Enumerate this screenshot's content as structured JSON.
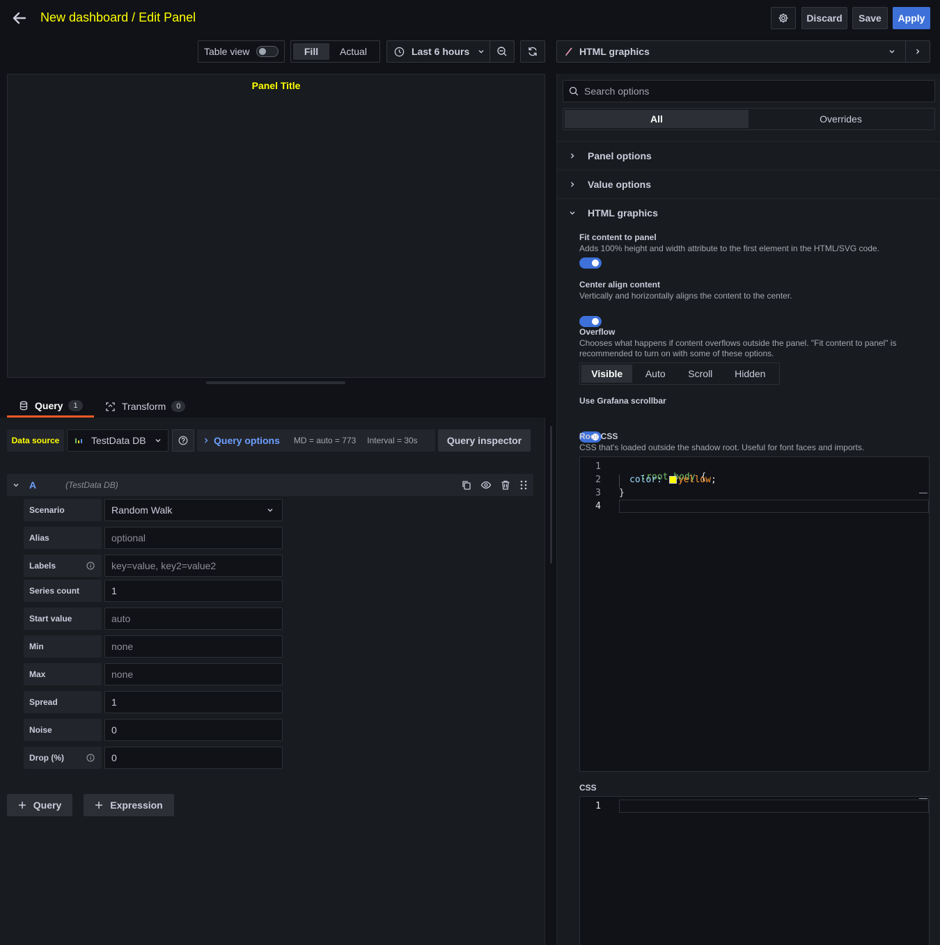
{
  "header": {
    "title": "New dashboard / Edit Panel",
    "discard": "Discard",
    "save": "Save",
    "apply": "Apply"
  },
  "toolbar": {
    "table_view": "Table view",
    "fill": "Fill",
    "actual": "Actual",
    "time_range": "Last 6 hours",
    "visualization": "HTML graphics"
  },
  "preview": {
    "panel_title": "Panel Title"
  },
  "query_tabs": {
    "query": "Query",
    "query_count": "1",
    "transform": "Transform",
    "transform_count": "0"
  },
  "datasource_row": {
    "label": "Data source",
    "value": "TestData DB",
    "query_options": "Query options",
    "md": "MD = auto = 773",
    "interval": "Interval = 30s",
    "inspector": "Query inspector"
  },
  "query_row": {
    "ref": "A",
    "ds": "(TestData DB)"
  },
  "fields": [
    {
      "label": "Scenario",
      "value": "Random Walk",
      "placeholder": false
    },
    {
      "label": "Alias",
      "value": "optional",
      "placeholder": true
    },
    {
      "label": "Labels",
      "value": "key=value, key2=value2",
      "placeholder": true
    },
    {
      "label": "Series count",
      "value": "1",
      "placeholder": false
    },
    {
      "label": "Start value",
      "value": "auto",
      "placeholder": true
    },
    {
      "label": "Min",
      "value": "none",
      "placeholder": true
    },
    {
      "label": "Max",
      "value": "none",
      "placeholder": true
    },
    {
      "label": "Spread",
      "value": "1",
      "placeholder": false
    },
    {
      "label": "Noise",
      "value": "0",
      "placeholder": false
    },
    {
      "label": "Drop (%)",
      "value": "0",
      "placeholder": false
    }
  ],
  "bottom_buttons": {
    "query": "Query",
    "expression": "Expression"
  },
  "options": {
    "search_placeholder": "Search options",
    "tab_all": "All",
    "tab_overrides": "Overrides",
    "sections": [
      "Panel options",
      "Value options",
      "HTML graphics"
    ],
    "fit": {
      "title": "Fit content to panel",
      "desc": "Adds 100% height and width attribute to the first element in the HTML/SVG code.",
      "on": true
    },
    "center": {
      "title": "Center align content",
      "desc": "Vertically and horizontally aligns the content to the center.",
      "on": true
    },
    "overflow": {
      "title": "Overflow",
      "desc": "Chooses what happens if content overflows outside the panel. \"Fit content to panel\" is recommended to turn on with some of these options.",
      "choices": [
        "Visible",
        "Auto",
        "Scroll",
        "Hidden"
      ],
      "selected": "Visible"
    },
    "scrollbar": {
      "title": "Use Grafana scrollbar",
      "on": true
    },
    "root_css": {
      "title": "Root CSS",
      "desc": "CSS that's loaded outside the shadow root. Useful for font faces and imports.",
      "line_numbers": [
        "1",
        "2",
        "3",
        "4"
      ],
      "l1_selector": ":root body",
      "l1_brace": "{",
      "l2_prop": "color:",
      "l2_value": "yellow",
      "l2_semi": ";",
      "l3": "}"
    },
    "css": {
      "title": "CSS",
      "line_numbers": [
        "1"
      ]
    }
  },
  "colors": {
    "accent_yellow": "#ffff00",
    "apply_blue": "#3d71d9",
    "link_blue": "#6e9fff",
    "tab_underline": "#f05a28"
  }
}
